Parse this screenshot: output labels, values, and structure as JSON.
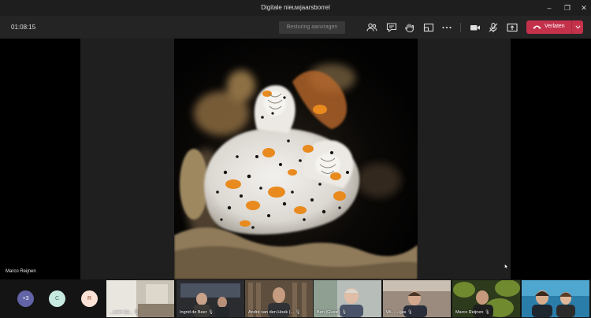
{
  "window": {
    "title": "Digitale nieuwjaarsborrel",
    "minimize_glyph": "–",
    "maximize_glyph": "❐",
    "close_glyph": "✕"
  },
  "toolbar": {
    "timer": "01:08:15",
    "request_control_label": "Besturing aanvragen",
    "icons": [
      "people-icon",
      "chat-icon",
      "raise-hand-icon",
      "breakout-rooms-icon",
      "more-icon",
      "camera-icon",
      "mic-muted-icon",
      "share-tray-icon"
    ],
    "leave_label": "Verlaten",
    "leave_color": "#c4314b"
  },
  "stage": {
    "presenter_name": "Marco Reijnen"
  },
  "participants": {
    "avatars": [
      {
        "initials": "+3",
        "bg": "#6264a7",
        "fg": "#ffffff"
      },
      {
        "initials": "C",
        "bg": "#c6eae0",
        "fg": "#3a6b5e"
      },
      {
        "initials": "R",
        "bg": "#fbe3d6",
        "fg": "#8a4a36"
      }
    ],
    "tiles": [
      {
        "name": "...avier Sa...",
        "mic": "🎙"
      },
      {
        "name": "Ingrid de Beer",
        "mic": "🎙"
      },
      {
        "name": "André van den Hoek (...",
        "mic": "🎙"
      },
      {
        "name": "Ben (Guest)",
        "mic": "🎙"
      },
      {
        "name": "Wi... ...ijas",
        "mic": "🎙"
      },
      {
        "name": "Marco Reijnen",
        "mic": "🎙"
      },
      {
        "name": "",
        "mic": ""
      }
    ]
  }
}
